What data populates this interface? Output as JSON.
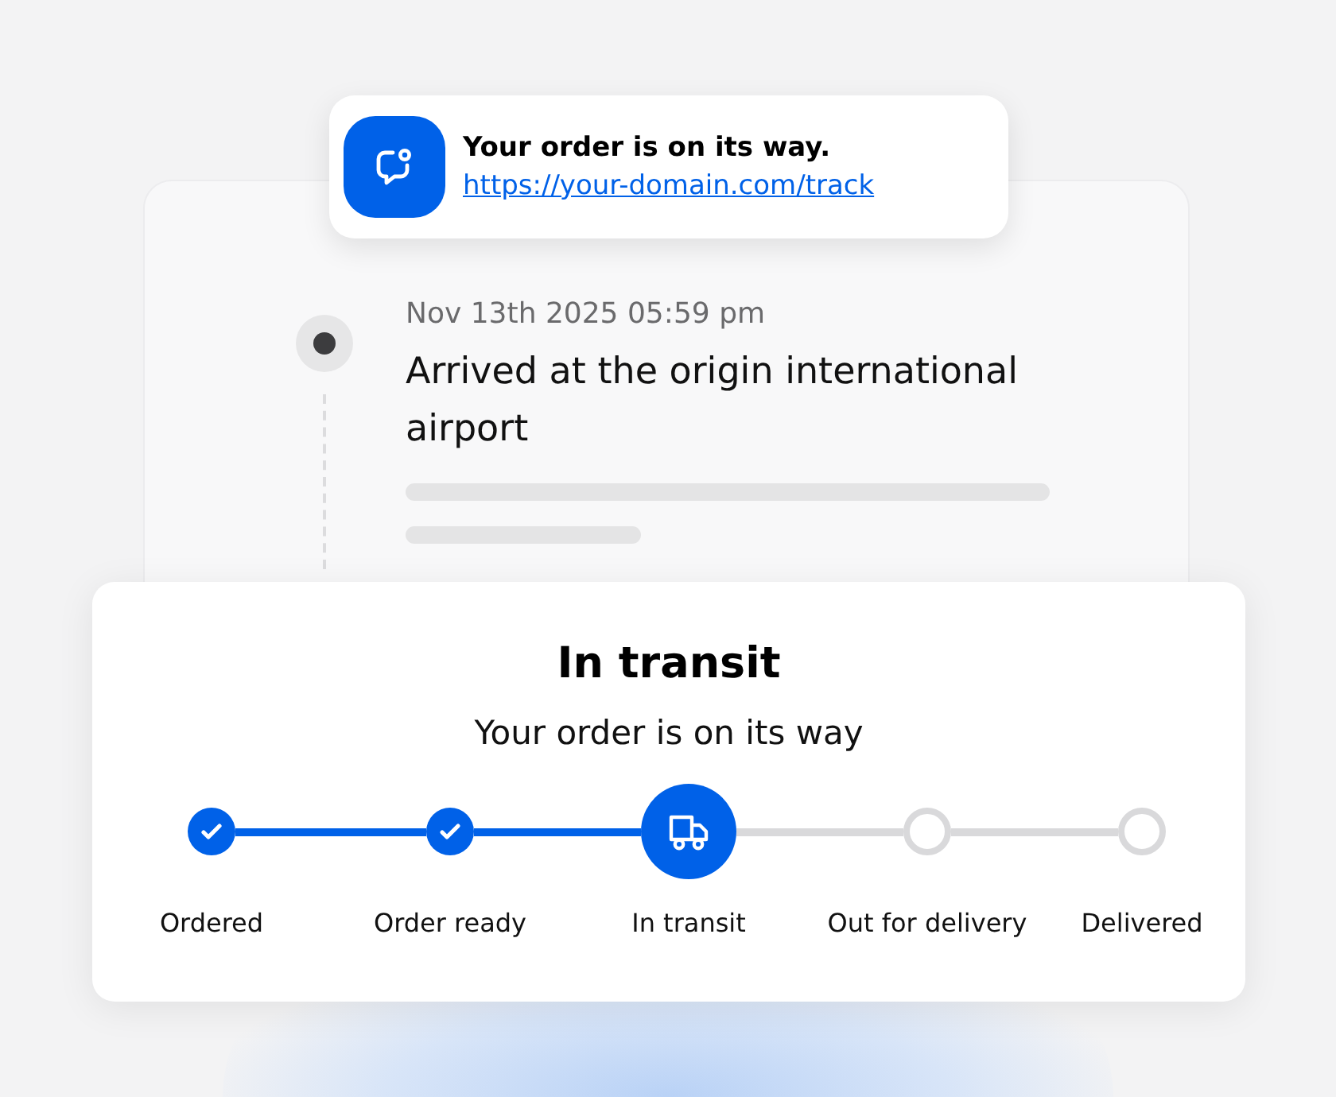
{
  "notification": {
    "title": "Your order is on its way.",
    "link": "https://your-domain.com/track"
  },
  "tracking_event": {
    "time": "Nov 13th 2025 05:59 pm",
    "description": "Arrived at the origin international airport"
  },
  "status_card": {
    "title": "In transit",
    "subtitle": "Your order is on its way"
  },
  "steps": [
    {
      "label": "Ordered",
      "kind": "done"
    },
    {
      "label": "Order ready",
      "kind": "done"
    },
    {
      "label": "In transit",
      "kind": "current"
    },
    {
      "label": "Out for delivery",
      "kind": "pending"
    },
    {
      "label": "Delivered",
      "kind": "pending"
    }
  ]
}
